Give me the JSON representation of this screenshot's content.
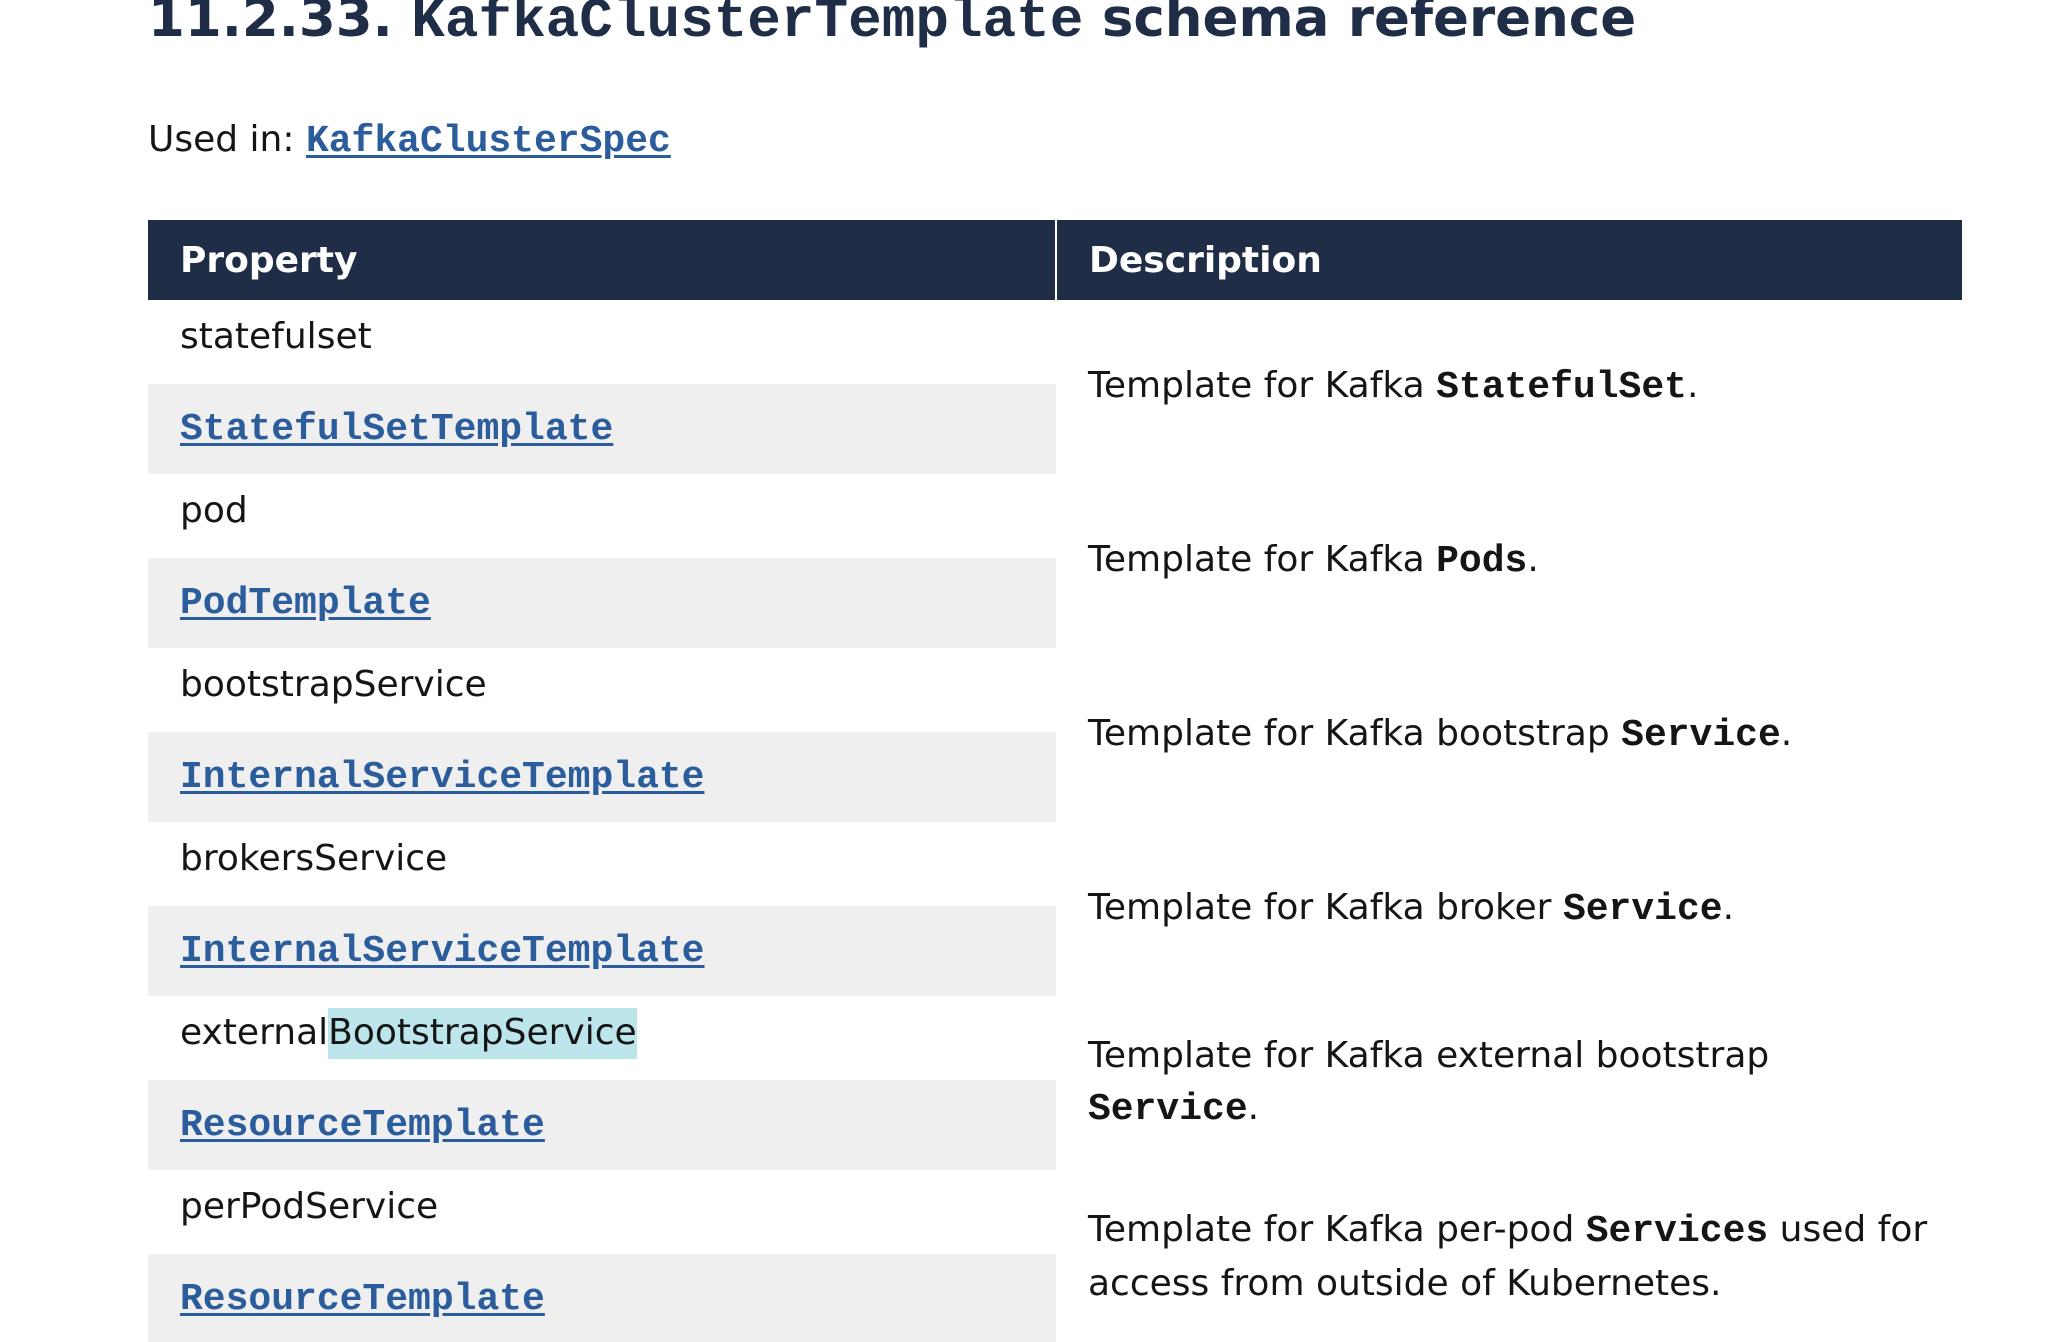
{
  "heading": {
    "number": "11.2.33.",
    "code": "KafkaClusterTemplate",
    "suffix": "schema reference"
  },
  "used_in": {
    "label": "Used in:",
    "link": "KafkaClusterSpec"
  },
  "table": {
    "headers": [
      "Property",
      "Description"
    ],
    "rows": [
      {
        "name": "statefulset",
        "type": "StatefulSetTemplate",
        "desc_pre": "Template for Kafka ",
        "desc_code": "StatefulSet",
        "desc_post": "."
      },
      {
        "name": "pod",
        "type": "PodTemplate",
        "desc_pre": "Template for Kafka ",
        "desc_code": "Pods",
        "desc_post": "."
      },
      {
        "name": "bootstrapService",
        "type": "InternalServiceTemplate",
        "desc_pre": "Template for Kafka bootstrap ",
        "desc_code": "Service",
        "desc_post": "."
      },
      {
        "name": "brokersService",
        "type": "InternalServiceTemplate",
        "desc_pre": "Template for Kafka broker ",
        "desc_code": "Service",
        "desc_post": "."
      },
      {
        "name_pre": "external",
        "name_highlight": "BootstrapService",
        "type": "ResourceTemplate",
        "desc_pre": "Template for Kafka external bootstrap ",
        "desc_code": "Service",
        "desc_post": "."
      },
      {
        "name": "perPodService",
        "type": "ResourceTemplate",
        "desc_pre": "Template for Kafka per-pod ",
        "desc_code": "Services",
        "desc_post": " used for access from outside of Kubernetes."
      }
    ]
  },
  "colors": {
    "header_bg": "#1f2d47",
    "link": "#2b5c9c",
    "row_alt": "#efefef",
    "highlight": "#bde6ec"
  }
}
